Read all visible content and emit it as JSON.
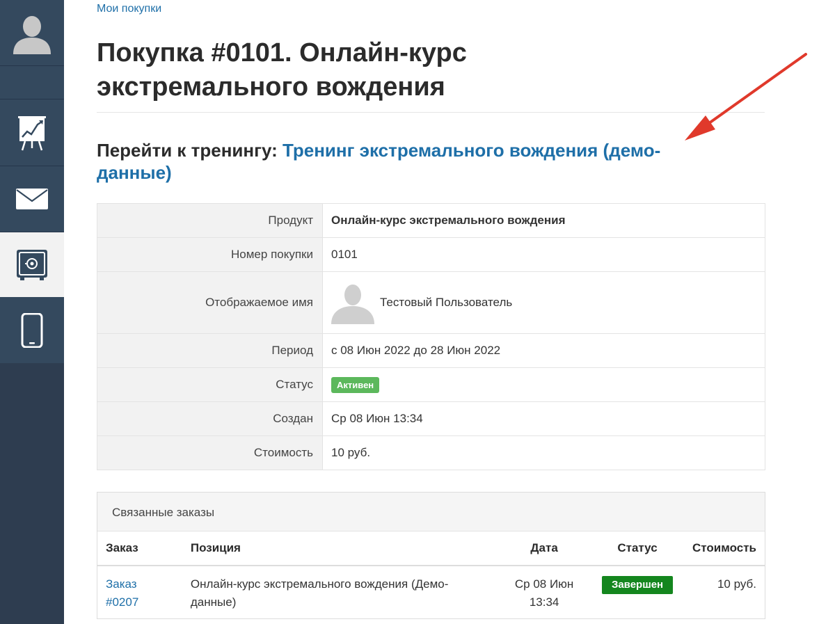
{
  "sidebar": {
    "items": [
      {
        "icon": "user-avatar-icon"
      },
      {
        "icon": "empty"
      },
      {
        "icon": "chart-board-icon"
      },
      {
        "icon": "mail-icon"
      },
      {
        "icon": "safe-icon",
        "active": true
      },
      {
        "icon": "mobile-phone-icon"
      }
    ]
  },
  "breadcrumb": "Мои покупки",
  "page_title": "Покупка #0101. Онлайн-курс экстремального вождения",
  "goto": {
    "prefix": "Перейти к тренингу:",
    "link": "Тренинг экстремального вождения (демо-данные)"
  },
  "details": {
    "product_label": "Продукт",
    "product_value": "Онлайн-курс экстремального вождения",
    "number_label": "Номер покупки",
    "number_value": "0101",
    "name_label": "Отображаемое имя",
    "name_value": "Тестовый Пользователь",
    "period_label": "Период",
    "period_value": "с 08 Июн 2022 до 28 Июн 2022",
    "status_label": "Статус",
    "status_value": "Активен",
    "created_label": "Создан",
    "created_value": "Ср 08 Июн 13:34",
    "cost_label": "Стоимость",
    "cost_value": "10 руб."
  },
  "orders": {
    "title": "Связанные заказы",
    "headers": {
      "order": "Заказ",
      "item": "Позиция",
      "date": "Дата",
      "status": "Статус",
      "cost": "Стоимость"
    },
    "rows": [
      {
        "order_line1": "Заказ",
        "order_line2": "#0207",
        "item_line1": "Онлайн-курс экстремального вождения (Демо-",
        "item_line2": "данные)",
        "date_line1": "Ср 08 Июн",
        "date_line2": "13:34",
        "status": "Завершен",
        "cost": "10 руб."
      }
    ]
  },
  "colors": {
    "sidebar": "#34495e",
    "link": "#1e6fa8",
    "badge_active": "#5cb85c",
    "badge_done": "#14861e",
    "arrow": "#e0392b"
  }
}
